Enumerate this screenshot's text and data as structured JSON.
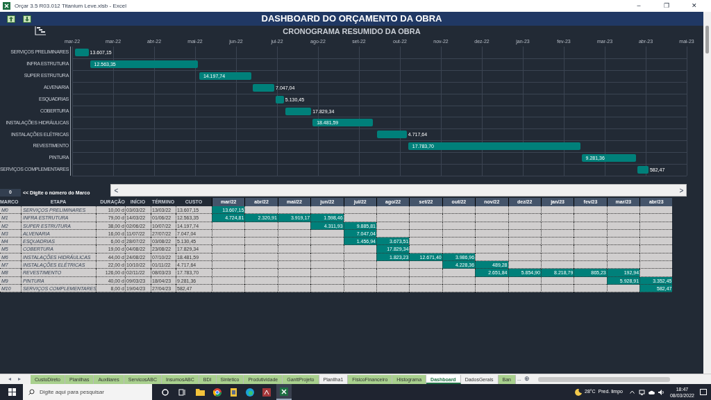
{
  "window": {
    "title": "Orçar 3.5 R03.012 Titanium Leve.xlsb - Excel",
    "controls": [
      "–",
      "❐",
      "✕"
    ]
  },
  "dashboard": {
    "title": "DASHBOARD DO ORÇAMENTO DA OBRA",
    "subtitle": "CRONOGRAMA RESUMIDO DA OBRA"
  },
  "gantt": {
    "ticks": [
      "mar-22",
      "mar-22",
      "abr-22",
      "mai-22",
      "jun-22",
      "jul-22",
      "ago-22",
      "set-22",
      "out-22",
      "nov-22",
      "dez-22",
      "jan-23",
      "fev-23",
      "mar-23",
      "abr-23",
      "mai-23"
    ],
    "tasks": [
      {
        "label": "SERVIÇOS PRELIMINARES",
        "value": "13.607,15"
      },
      {
        "label": "INFRA ESTRUTURA",
        "value": "12.563,35"
      },
      {
        "label": "SUPER ESTRUTURA",
        "value": "14.197,74"
      },
      {
        "label": "ALVENARIA",
        "value": "7.047,04"
      },
      {
        "label": "ESQUADRIAS",
        "value": "5.130,45"
      },
      {
        "label": "COBERTURA",
        "value": "17.829,34"
      },
      {
        "label": "INSTALAÇÕES HIDRÁULICAS",
        "value": "18.481,59"
      },
      {
        "label": "INSTALAÇÕES ELÉTRICAS",
        "value": "4.717,64"
      },
      {
        "label": "REVESTIMENTO",
        "value": "17.783,70"
      },
      {
        "label": "PINTURA",
        "value": "9.281,36"
      },
      {
        "label": "SERVIÇOS COMPLEMENTARES",
        "value": "582,47"
      }
    ]
  },
  "marco_input": {
    "value": "0",
    "hint": "<< Digite o número do Marco"
  },
  "scroll_buttons": [
    "<",
    ">"
  ],
  "table": {
    "columns": [
      "MARCO",
      "ETAPA",
      "DURAÇÃO",
      "INÍCIO",
      "TÉRMINO",
      "CUSTO"
    ],
    "months": [
      "mar/22",
      "abr/22",
      "mai/22",
      "jun/22",
      "jul/22",
      "ago/22",
      "set/22",
      "out/22",
      "nov/22",
      "dez/22",
      "jan/23",
      "fev/23",
      "mar/23",
      "abr/23"
    ],
    "rows": [
      {
        "marco": "M0",
        "etapa": "SERVIÇOS PRELIMINARES",
        "duracao": "10,00 d",
        "inicio": "03/03/22",
        "termino": "13/03/22",
        "custo": "13.607,15",
        "cells": [
          {
            "filled": true,
            "value": "13.607,15"
          },
          {
            "filled": false
          },
          {
            "filled": false
          },
          {
            "filled": false
          },
          {
            "filled": false
          },
          {
            "filled": false
          },
          {
            "filled": false
          },
          {
            "filled": false
          },
          {
            "filled": false
          },
          {
            "filled": false
          },
          {
            "filled": false
          },
          {
            "filled": false
          },
          {
            "filled": false
          },
          {
            "filled": false
          }
        ]
      },
      {
        "marco": "M1",
        "etapa": "INFRA ESTRUTURA",
        "duracao": "79,00 d",
        "inicio": "14/03/22",
        "termino": "01/06/22",
        "custo": "12.563,35",
        "cells": [
          {
            "filled": true,
            "value": "4.724,81"
          },
          {
            "filled": true,
            "value": "2.320,91"
          },
          {
            "filled": true,
            "value": "3.919,17"
          },
          {
            "filled": true,
            "value": "1.598,46"
          },
          {
            "filled": false
          },
          {
            "filled": false
          },
          {
            "filled": false
          },
          {
            "filled": false
          },
          {
            "filled": false
          },
          {
            "filled": false
          },
          {
            "filled": false
          },
          {
            "filled": false
          },
          {
            "filled": false
          },
          {
            "filled": false
          }
        ]
      },
      {
        "marco": "M2",
        "etapa": "SUPER ESTRUTURA",
        "duracao": "38,00 d",
        "inicio": "02/06/22",
        "termino": "10/07/22",
        "custo": "14.197,74",
        "cells": [
          {
            "filled": false
          },
          {
            "filled": false
          },
          {
            "filled": false
          },
          {
            "filled": true,
            "value": "4.311,93"
          },
          {
            "filled": true,
            "value": "9.885,81"
          },
          {
            "filled": false
          },
          {
            "filled": false
          },
          {
            "filled": false
          },
          {
            "filled": false
          },
          {
            "filled": false
          },
          {
            "filled": false
          },
          {
            "filled": false
          },
          {
            "filled": false
          },
          {
            "filled": false
          }
        ]
      },
      {
        "marco": "M3",
        "etapa": "ALVENARIA",
        "duracao": "16,00 d",
        "inicio": "11/07/22",
        "termino": "27/07/22",
        "custo": "7.047,04",
        "cells": [
          {
            "filled": false
          },
          {
            "filled": false
          },
          {
            "filled": false
          },
          {
            "filled": false
          },
          {
            "filled": true,
            "value": "7.047,04"
          },
          {
            "filled": false
          },
          {
            "filled": false
          },
          {
            "filled": false
          },
          {
            "filled": false
          },
          {
            "filled": false
          },
          {
            "filled": false
          },
          {
            "filled": false
          },
          {
            "filled": false
          },
          {
            "filled": false
          }
        ]
      },
      {
        "marco": "M4",
        "etapa": "ESQUADRIAS",
        "duracao": "6,00 d",
        "inicio": "28/07/22",
        "termino": "03/08/22",
        "custo": "5.130,45",
        "cells": [
          {
            "filled": false
          },
          {
            "filled": false
          },
          {
            "filled": false
          },
          {
            "filled": false
          },
          {
            "filled": true,
            "value": "1.456,94"
          },
          {
            "filled": true,
            "value": "3.673,51"
          },
          {
            "filled": false
          },
          {
            "filled": false
          },
          {
            "filled": false
          },
          {
            "filled": false
          },
          {
            "filled": false
          },
          {
            "filled": false
          },
          {
            "filled": false
          },
          {
            "filled": false
          }
        ]
      },
      {
        "marco": "M5",
        "etapa": "COBERTURA",
        "duracao": "19,00 d",
        "inicio": "04/08/22",
        "termino": "23/08/22",
        "custo": "17.829,34",
        "cells": [
          {
            "filled": false
          },
          {
            "filled": false
          },
          {
            "filled": false
          },
          {
            "filled": false
          },
          {
            "filled": false
          },
          {
            "filled": true,
            "value": "17.829,34"
          },
          {
            "filled": false
          },
          {
            "filled": false
          },
          {
            "filled": false
          },
          {
            "filled": false
          },
          {
            "filled": false
          },
          {
            "filled": false
          },
          {
            "filled": false
          },
          {
            "filled": false
          }
        ]
      },
      {
        "marco": "M6",
        "etapa": "INSTALAÇÕES HIDRÁULICAS",
        "duracao": "44,00 d",
        "inicio": "24/08/22",
        "termino": "07/10/22",
        "custo": "18.481,59",
        "cells": [
          {
            "filled": false
          },
          {
            "filled": false
          },
          {
            "filled": false
          },
          {
            "filled": false
          },
          {
            "filled": false
          },
          {
            "filled": true,
            "value": "1.823,23"
          },
          {
            "filled": true,
            "value": "12.671,40"
          },
          {
            "filled": true,
            "value": "3.986,96"
          },
          {
            "filled": false
          },
          {
            "filled": false
          },
          {
            "filled": false
          },
          {
            "filled": false
          },
          {
            "filled": false
          },
          {
            "filled": false
          }
        ]
      },
      {
        "marco": "M7",
        "etapa": "INSTALAÇÕES ELÉTRICAS",
        "duracao": "22,00 d",
        "inicio": "10/10/22",
        "termino": "01/11/22",
        "custo": "4.717,64",
        "cells": [
          {
            "filled": false
          },
          {
            "filled": false
          },
          {
            "filled": false
          },
          {
            "filled": false
          },
          {
            "filled": false
          },
          {
            "filled": false
          },
          {
            "filled": false
          },
          {
            "filled": true,
            "value": "4.228,36"
          },
          {
            "filled": true,
            "value": "489,28"
          },
          {
            "filled": false
          },
          {
            "filled": false
          },
          {
            "filled": false
          },
          {
            "filled": false
          },
          {
            "filled": false
          }
        ]
      },
      {
        "marco": "M8",
        "etapa": "REVESTIMENTO",
        "duracao": "126,00 d",
        "inicio": "02/11/22",
        "termino": "08/03/23",
        "custo": "17.783,70",
        "cells": [
          {
            "filled": false
          },
          {
            "filled": false
          },
          {
            "filled": false
          },
          {
            "filled": false
          },
          {
            "filled": false
          },
          {
            "filled": false
          },
          {
            "filled": false
          },
          {
            "filled": false
          },
          {
            "filled": true,
            "value": "2.651,84"
          },
          {
            "filled": true,
            "value": "5.854,90"
          },
          {
            "filled": true,
            "value": "8.218,79"
          },
          {
            "filled": true,
            "value": "865,23"
          },
          {
            "filled": true,
            "value": "192,94"
          },
          {
            "filled": false
          }
        ]
      },
      {
        "marco": "M9",
        "etapa": "PINTURA",
        "duracao": "40,00 d",
        "inicio": "09/03/23",
        "termino": "18/04/23",
        "custo": "9.281,36",
        "cells": [
          {
            "filled": false
          },
          {
            "filled": false
          },
          {
            "filled": false
          },
          {
            "filled": false
          },
          {
            "filled": false
          },
          {
            "filled": false
          },
          {
            "filled": false
          },
          {
            "filled": false
          },
          {
            "filled": false
          },
          {
            "filled": false
          },
          {
            "filled": false
          },
          {
            "filled": false
          },
          {
            "filled": true,
            "value": "5.928,91"
          },
          {
            "filled": true,
            "value": "3.352,45"
          }
        ]
      },
      {
        "marco": "M10",
        "etapa": "SERVIÇOS COMPLEMENTARES",
        "duracao": "8,00 d",
        "inicio": "19/04/23",
        "termino": "27/04/23",
        "custo": "582,47",
        "cells": [
          {
            "filled": false
          },
          {
            "filled": false
          },
          {
            "filled": false
          },
          {
            "filled": false
          },
          {
            "filled": false
          },
          {
            "filled": false
          },
          {
            "filled": false
          },
          {
            "filled": false
          },
          {
            "filled": false
          },
          {
            "filled": false
          },
          {
            "filled": false
          },
          {
            "filled": false
          },
          {
            "filled": false
          },
          {
            "filled": true,
            "value": "582,47"
          }
        ]
      }
    ]
  },
  "sheet_tabs": [
    {
      "label": "CustoDireto",
      "selected": false,
      "color": "#a9d08e"
    },
    {
      "label": "Planilhas",
      "selected": false,
      "color": "#a9d08e"
    },
    {
      "label": "Auxiliares",
      "selected": false,
      "color": "#a9d08e"
    },
    {
      "label": "ServicosABC",
      "selected": false,
      "color": "#a9d08e"
    },
    {
      "label": "InsumosABC",
      "selected": false,
      "color": "#a9d08e"
    },
    {
      "label": "BDI",
      "selected": false,
      "color": "#a9d08e"
    },
    {
      "label": "Sintetico",
      "selected": false,
      "color": "#a9d08e"
    },
    {
      "label": "Produtividade",
      "selected": false,
      "color": "#a9d08e"
    },
    {
      "label": "GanttProjeto",
      "selected": false,
      "color": "#a9d08e"
    },
    {
      "label": "Planilha1",
      "selected": false
    },
    {
      "label": "FisicoFinanceiro",
      "selected": false,
      "color": "#a9d08e"
    },
    {
      "label": "Histograma",
      "selected": false,
      "color": "#a9d08e"
    },
    {
      "label": "Dashboard",
      "selected": true
    },
    {
      "label": "DadosGerais",
      "selected": false
    },
    {
      "label": "Ban",
      "selected": false,
      "color": "#a9d08e"
    }
  ],
  "sheet_nav": {
    "prev": "◂",
    "next": "▸",
    "more": "...",
    "add": "⊕"
  },
  "taskbar": {
    "search_placeholder": "Digite aqui para pesquisar",
    "weather": "28°C  Pred. limpo",
    "time": "18:47",
    "date": "08/03/2022"
  }
}
